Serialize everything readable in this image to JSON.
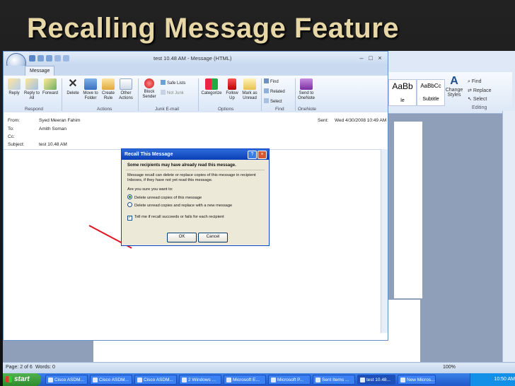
{
  "slide": {
    "title": "Recalling Message Feature"
  },
  "word": {
    "styles": [
      "AaBb",
      "AaBbCc",
      "AaBbCc"
    ],
    "style_labels": [
      "le",
      "Subtitle",
      "Change Styles"
    ],
    "editing": {
      "find": "Find",
      "replace": "Replace",
      "select": "Select",
      "group": "Editing"
    },
    "status": {
      "page": "Page: 2 of 6",
      "words": "Words: 0",
      "zoom": "100%"
    }
  },
  "outlook": {
    "window_title": "test 10.48 AM - Message (HTML)",
    "tab": "Message",
    "ribbon": {
      "reply": "Reply",
      "reply_all": "Reply to All",
      "forward": "Forward",
      "group_respond": "Respond",
      "delete": "Delete",
      "move_to_folder": "Move to Folder",
      "create_rule": "Create Rule",
      "other_actions": "Other Actions",
      "group_actions": "Actions",
      "block_sender": "Block Sender",
      "safe_lists": "Safe Lists",
      "not_junk": "Not Junk",
      "group_junk": "Junk E-mail",
      "categorize": "Categorize",
      "follow_up": "Follow Up",
      "mark_as_unread": "Mark as Unread",
      "group_options": "Options",
      "find": "Find",
      "related": "Related",
      "select": "Select",
      "group_find": "Find",
      "send_to_onenote": "Send to OneNote",
      "group_onenote": "OneNote"
    },
    "header": {
      "from_label": "From:",
      "from_value": "Syed Meeran Fahim",
      "to_label": "To:",
      "to_value": "Amith Soman",
      "cc_label": "Cc:",
      "cc_value": "",
      "subject_label": "Subject:",
      "subject_value": "test 10.48 AM",
      "sent_label": "Sent:",
      "sent_value": "Wed 4/30/2008 10:49 AM"
    }
  },
  "dialog": {
    "title": "Recall This Message",
    "warning": "Some recipients may have already read this message.",
    "info": "Message recall can delete or replace copies of this message in recipient Inboxes, if they have not yet read this message.",
    "question": "Are you sure you want to:",
    "option_delete": "Delete unread copies of this message",
    "option_replace": "Delete unread copies and replace with a new message",
    "tell_me": "Tell me if recall succeeds or fails for each recipient",
    "ok": "OK",
    "cancel": "Cancel"
  },
  "taskbar": {
    "start": "start",
    "items": [
      "Cisco ASDM...",
      "Cisco ASDM...",
      "Cisco ASDM...",
      "2 Windows ...",
      "Microsoft E...",
      "Microsoft P...",
      "Sent Items ...",
      "test 10.48...",
      "New Micros..."
    ],
    "clock": "10:50 AM"
  }
}
